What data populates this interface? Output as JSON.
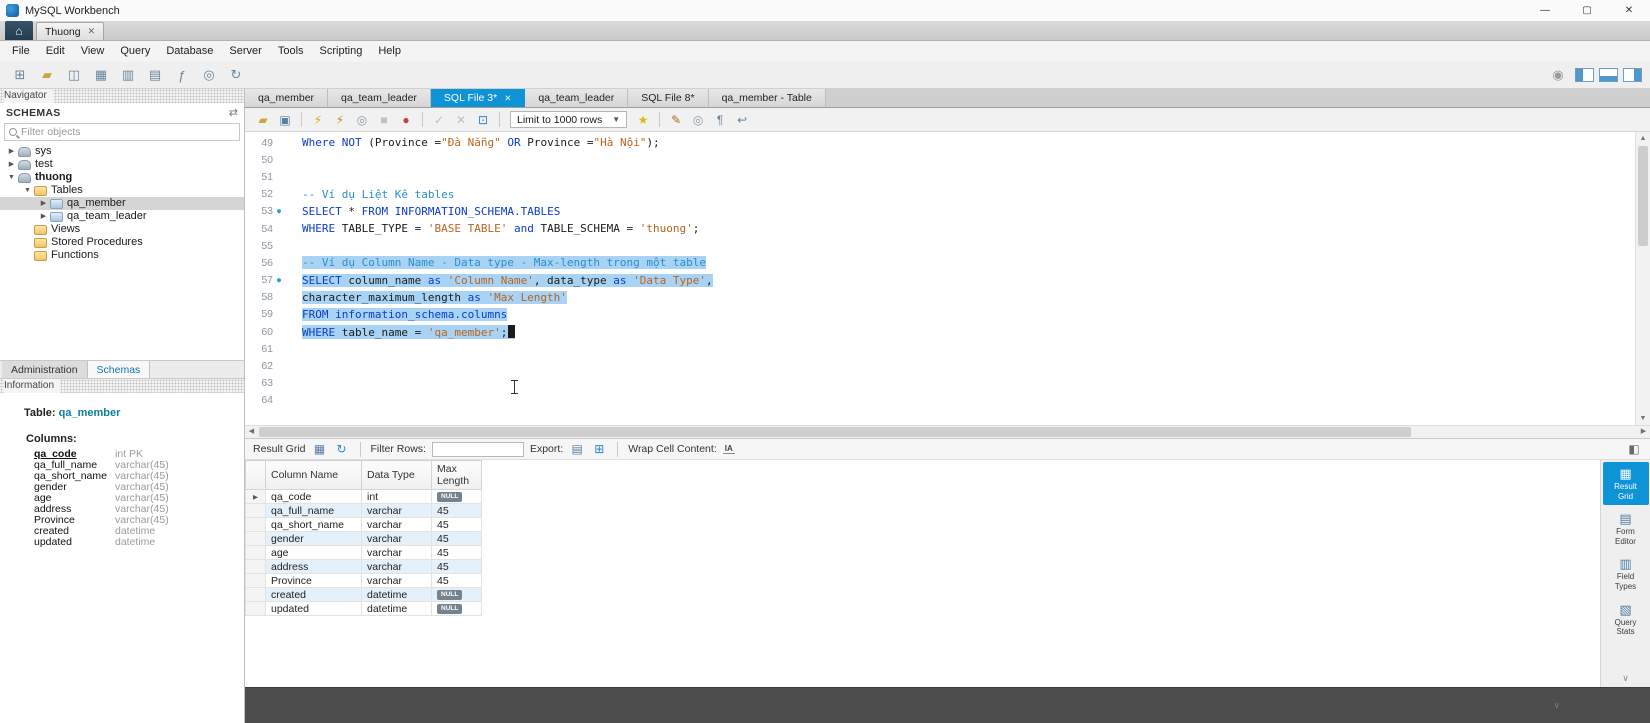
{
  "colors": {
    "active_tab": "#0e93d7",
    "selection": "#a9d3f5",
    "kw": "#0b3ccc",
    "str": "#b8651f",
    "com": "#2d8ec9",
    "null_badge": "#75828f",
    "alt_row": "#e4f1fb"
  },
  "icons": {
    "home": "⌂",
    "account": "◉",
    "schema_sync": "⇄",
    "close_tab": "✕",
    "scroll_up": "▲",
    "scroll_down": "▼",
    "scroll_left": "◀",
    "scroll_right": "▶",
    "chevron": "∨"
  },
  "window": {
    "title": "MySQL Workbench",
    "controls": {
      "minimize": "—",
      "maximize": "▢",
      "close": "✕"
    }
  },
  "home_strip": {
    "tab": "Thuong"
  },
  "menu": {
    "items": [
      "File",
      "Edit",
      "View",
      "Query",
      "Database",
      "Server",
      "Tools",
      "Scripting",
      "Help"
    ]
  },
  "main_toolbar": {
    "icons": [
      {
        "name": "new-sql-tab-icon",
        "glyph": "⊞",
        "color": "#68879f"
      },
      {
        "name": "open-sql-script-icon",
        "glyph": "▰",
        "color": "#cda43f"
      },
      {
        "name": "create-schema-icon",
        "glyph": "◫",
        "color": "#68879f"
      },
      {
        "name": "create-table-icon",
        "glyph": "▦",
        "color": "#68879f"
      },
      {
        "name": "create-view-icon",
        "glyph": "▥",
        "color": "#68879f"
      },
      {
        "name": "create-procedure-icon",
        "glyph": "▤",
        "color": "#68879f"
      },
      {
        "name": "create-function-icon",
        "glyph": "ƒ",
        "color": "#68879f"
      },
      {
        "name": "search-data-icon",
        "glyph": "◎",
        "color": "#68879f"
      },
      {
        "name": "reconnect-dbms-icon",
        "glyph": "↻",
        "color": "#68879f"
      }
    ]
  },
  "navigator": {
    "header": "Navigator",
    "schemas_title": "SCHEMAS",
    "filter_placeholder": "Filter objects",
    "tree": [
      {
        "label": "sys",
        "level": 0,
        "expand": false,
        "icon": "schema"
      },
      {
        "label": "test",
        "level": 0,
        "expand": false,
        "icon": "schema"
      },
      {
        "label": "thuong",
        "level": 0,
        "expand": true,
        "icon": "schema",
        "bold": true
      },
      {
        "label": "Tables",
        "level": 1,
        "expand": true,
        "icon": "folder"
      },
      {
        "label": "qa_member",
        "level": 2,
        "expand": false,
        "icon": "table",
        "selected": true
      },
      {
        "label": "qa_team_leader",
        "level": 2,
        "expand": false,
        "icon": "table"
      },
      {
        "label": "Views",
        "level": 1,
        "expand": null,
        "icon": "folder"
      },
      {
        "label": "Stored Procedures",
        "level": 1,
        "expand": null,
        "icon": "folder"
      },
      {
        "label": "Functions",
        "level": 1,
        "expand": null,
        "icon": "folder"
      }
    ],
    "bottom_tabs": [
      {
        "label": "Administration",
        "active": false
      },
      {
        "label": "Schemas",
        "active": true
      }
    ],
    "information_header": "Information",
    "info": {
      "table_label": "Table:",
      "table_name": "qa_member",
      "columns_label": "Columns:",
      "columns": [
        {
          "name": "qa_code",
          "type": "int PK",
          "pk": true
        },
        {
          "name": "qa_full_name",
          "type": "varchar(45)"
        },
        {
          "name": "qa_short_name",
          "type": "varchar(45)"
        },
        {
          "name": "gender",
          "type": "varchar(45)"
        },
        {
          "name": "age",
          "type": "varchar(45)"
        },
        {
          "name": "address",
          "type": "varchar(45)"
        },
        {
          "name": "Province",
          "type": "varchar(45)"
        },
        {
          "name": "created",
          "type": "datetime"
        },
        {
          "name": "updated",
          "type": "datetime"
        }
      ]
    }
  },
  "editor_tabs": [
    {
      "label": "qa_member"
    },
    {
      "label": "qa_team_leader"
    },
    {
      "label": "SQL File 3*",
      "active": true
    },
    {
      "label": "qa_team_leader"
    },
    {
      "label": "SQL File 8*"
    },
    {
      "label": "qa_member - Table"
    }
  ],
  "sql_toolbar": {
    "items": [
      {
        "type": "icon",
        "name": "open-script-icon",
        "glyph": "▰",
        "color": "#cda43f"
      },
      {
        "type": "icon",
        "name": "save-script-icon",
        "glyph": "▣",
        "color": "#5b7fa6"
      },
      {
        "type": "sep"
      },
      {
        "type": "icon",
        "name": "execute-icon",
        "glyph": "⚡",
        "color": "#e8a013"
      },
      {
        "type": "icon",
        "name": "execute-current-statement-icon",
        "glyph": "⚡",
        "color": "#c98a10"
      },
      {
        "type": "icon",
        "name": "explain-icon",
        "glyph": "◎",
        "color": "#8a9aaa"
      },
      {
        "type": "icon",
        "name": "stop-icon",
        "glyph": "■",
        "color": "#c0c0c0"
      },
      {
        "type": "icon",
        "name": "stop-on-error-icon",
        "glyph": "●",
        "color": "#c4433c"
      },
      {
        "type": "sep"
      },
      {
        "type": "icon",
        "name": "commit-icon",
        "glyph": "✓",
        "color": "#bdbdbd"
      },
      {
        "type": "icon",
        "name": "rollback-icon",
        "glyph": "✕",
        "color": "#bdbdbd"
      },
      {
        "type": "icon",
        "name": "autocommit-icon",
        "glyph": "⊡",
        "color": "#2f86c8"
      },
      {
        "type": "sep"
      },
      {
        "type": "limit",
        "value": "Limit to 1000 rows"
      },
      {
        "type": "icon",
        "name": "save-snippet-icon",
        "glyph": "★",
        "color": "#e5b416"
      },
      {
        "type": "sep"
      },
      {
        "type": "icon",
        "name": "beautify-query-icon",
        "glyph": "✎",
        "color": "#b5651d"
      },
      {
        "type": "icon",
        "name": "find-icon",
        "glyph": "◎",
        "color": "#8a9aaa"
      },
      {
        "type": "icon",
        "name": "invisible-characters-icon",
        "glyph": "¶",
        "color": "#68879f"
      },
      {
        "type": "icon",
        "name": "wrap-text-icon",
        "glyph": "↩",
        "color": "#68879f"
      }
    ]
  },
  "editor": {
    "lines": [
      {
        "n": 49,
        "tokens": [
          {
            "t": "Where",
            "c": "k"
          },
          {
            "t": " ",
            "c": "p"
          },
          {
            "t": "NOT",
            "c": "k"
          },
          {
            "t": " (Province =",
            "c": "p"
          },
          {
            "t": "\"Đà Nẵng\"",
            "c": "s"
          },
          {
            "t": " ",
            "c": "p"
          },
          {
            "t": "OR",
            "c": "k"
          },
          {
            "t": " Province =",
            "c": "p"
          },
          {
            "t": "\"Hà Nội\"",
            "c": "s"
          },
          {
            "t": ");",
            "c": "p"
          }
        ]
      },
      {
        "n": 50,
        "tokens": []
      },
      {
        "n": 51,
        "tokens": []
      },
      {
        "n": 52,
        "tokens": [
          {
            "t": "-- Ví dụ Liệt Kê tables",
            "c": "c"
          }
        ]
      },
      {
        "n": 53,
        "marker": true,
        "tokens": [
          {
            "t": "SELECT",
            "c": "k"
          },
          {
            "t": " * ",
            "c": "p"
          },
          {
            "t": "FROM",
            "c": "k"
          },
          {
            "t": " INFORMATION_SCHEMA.TABLES",
            "c": "k"
          }
        ]
      },
      {
        "n": 54,
        "tokens": [
          {
            "t": "WHERE",
            "c": "k"
          },
          {
            "t": " TABLE_TYPE = ",
            "c": "p"
          },
          {
            "t": "'BASE TABLE'",
            "c": "s"
          },
          {
            "t": " ",
            "c": "p"
          },
          {
            "t": "and",
            "c": "k"
          },
          {
            "t": " TABLE_SCHEMA = ",
            "c": "p"
          },
          {
            "t": "'thuong'",
            "c": "s"
          },
          {
            "t": ";",
            "c": "p"
          }
        ]
      },
      {
        "n": 55,
        "tokens": []
      },
      {
        "n": 56,
        "sel": true,
        "tokens": [
          {
            "t": "-- Ví dụ Column Name - Data type - Max-length trong một table",
            "c": "c"
          }
        ]
      },
      {
        "n": 57,
        "marker": true,
        "sel": true,
        "tokens": [
          {
            "t": "SELECT",
            "c": "k"
          },
          {
            "t": " column_name ",
            "c": "p"
          },
          {
            "t": "as",
            "c": "k"
          },
          {
            "t": " ",
            "c": "p"
          },
          {
            "t": "'Column Name'",
            "c": "s"
          },
          {
            "t": ", data_type ",
            "c": "p"
          },
          {
            "t": "as",
            "c": "k"
          },
          {
            "t": " ",
            "c": "p"
          },
          {
            "t": "'Data Type'",
            "c": "s"
          },
          {
            "t": ",",
            "c": "p"
          }
        ]
      },
      {
        "n": 58,
        "sel": true,
        "tokens": [
          {
            "t": "character_maximum_length ",
            "c": "p"
          },
          {
            "t": "as",
            "c": "k"
          },
          {
            "t": " ",
            "c": "p"
          },
          {
            "t": "'Max Length'",
            "c": "s"
          }
        ]
      },
      {
        "n": 59,
        "sel": true,
        "tokens": [
          {
            "t": "FROM",
            "c": "k"
          },
          {
            "t": " information_schema.columns",
            "c": "k"
          }
        ]
      },
      {
        "n": 60,
        "sel": true,
        "caret": true,
        "tokens": [
          {
            "t": "WHERE",
            "c": "k"
          },
          {
            "t": " table_name = ",
            "c": "p"
          },
          {
            "t": "'qa_member'",
            "c": "s"
          },
          {
            "t": ";",
            "c": "p"
          }
        ]
      },
      {
        "n": 61,
        "tokens": []
      },
      {
        "n": 62,
        "tokens": []
      },
      {
        "n": 63,
        "tokens": []
      },
      {
        "n": 64,
        "tokens": []
      }
    ]
  },
  "result_toolbar": {
    "items": [
      {
        "type": "label",
        "text": "Result Grid",
        "name": "result-grid-label"
      },
      {
        "type": "icon",
        "name": "grid-view-icon",
        "glyph": "▦",
        "color": "#5b7fa6"
      },
      {
        "type": "icon",
        "name": "refresh-icon",
        "glyph": "↻",
        "color": "#2f86c8"
      },
      {
        "type": "sep"
      },
      {
        "type": "label",
        "text": "Filter Rows:",
        "name": "filter-rows-label"
      },
      {
        "type": "input",
        "name": "filter-rows-input",
        "value": ""
      },
      {
        "type": "label",
        "text": "Export:",
        "name": "export-label"
      },
      {
        "type": "icon",
        "name": "export-icon",
        "glyph": "▤",
        "color": "#5b7fa6"
      },
      {
        "type": "icon",
        "name": "import-icon",
        "glyph": "⊞",
        "color": "#2f86c8"
      },
      {
        "type": "sep"
      },
      {
        "type": "label",
        "text": "Wrap Cell Content:",
        "name": "wrap-cell-content-label"
      },
      {
        "type": "icon",
        "name": "wrap-cell-content-icon",
        "glyph": "ΙA",
        "color": "#444",
        "small": true
      },
      {
        "type": "spacer"
      },
      {
        "type": "icon",
        "name": "collapse-result-panel-icon",
        "glyph": "◧",
        "color": "#6a6a6a"
      }
    ]
  },
  "result_grid": {
    "headers": [
      "Column Name",
      "Data Type",
      "Max Length"
    ],
    "rows": [
      {
        "column_name": "qa_code",
        "data_type": "int",
        "max_length": "NULL",
        "is_null": true
      },
      {
        "column_name": "qa_full_name",
        "data_type": "varchar",
        "max_length": "45"
      },
      {
        "column_name": "qa_short_name",
        "data_type": "varchar",
        "max_length": "45"
      },
      {
        "column_name": "gender",
        "data_type": "varchar",
        "max_length": "45"
      },
      {
        "column_name": "age",
        "data_type": "varchar",
        "max_length": "45"
      },
      {
        "column_name": "address",
        "data_type": "varchar",
        "max_length": "45"
      },
      {
        "column_name": "Province",
        "data_type": "varchar",
        "max_length": "45"
      },
      {
        "column_name": "created",
        "data_type": "datetime",
        "max_length": "NULL",
        "is_null": true
      },
      {
        "column_name": "updated",
        "data_type": "datetime",
        "max_length": "NULL",
        "is_null": true
      }
    ]
  },
  "result_sidebar": {
    "buttons": [
      {
        "label": "Result Grid",
        "icon": "result-grid-icon",
        "glyph": "▦",
        "active": true
      },
      {
        "label": "Form Editor",
        "icon": "form-editor-icon",
        "glyph": "▤",
        "active": false
      },
      {
        "label": "Field Types",
        "icon": "field-types-icon",
        "glyph": "▥",
        "active": false
      },
      {
        "label": "Query Stats",
        "icon": "query-stats-icon",
        "glyph": "▧",
        "active": false
      }
    ]
  }
}
